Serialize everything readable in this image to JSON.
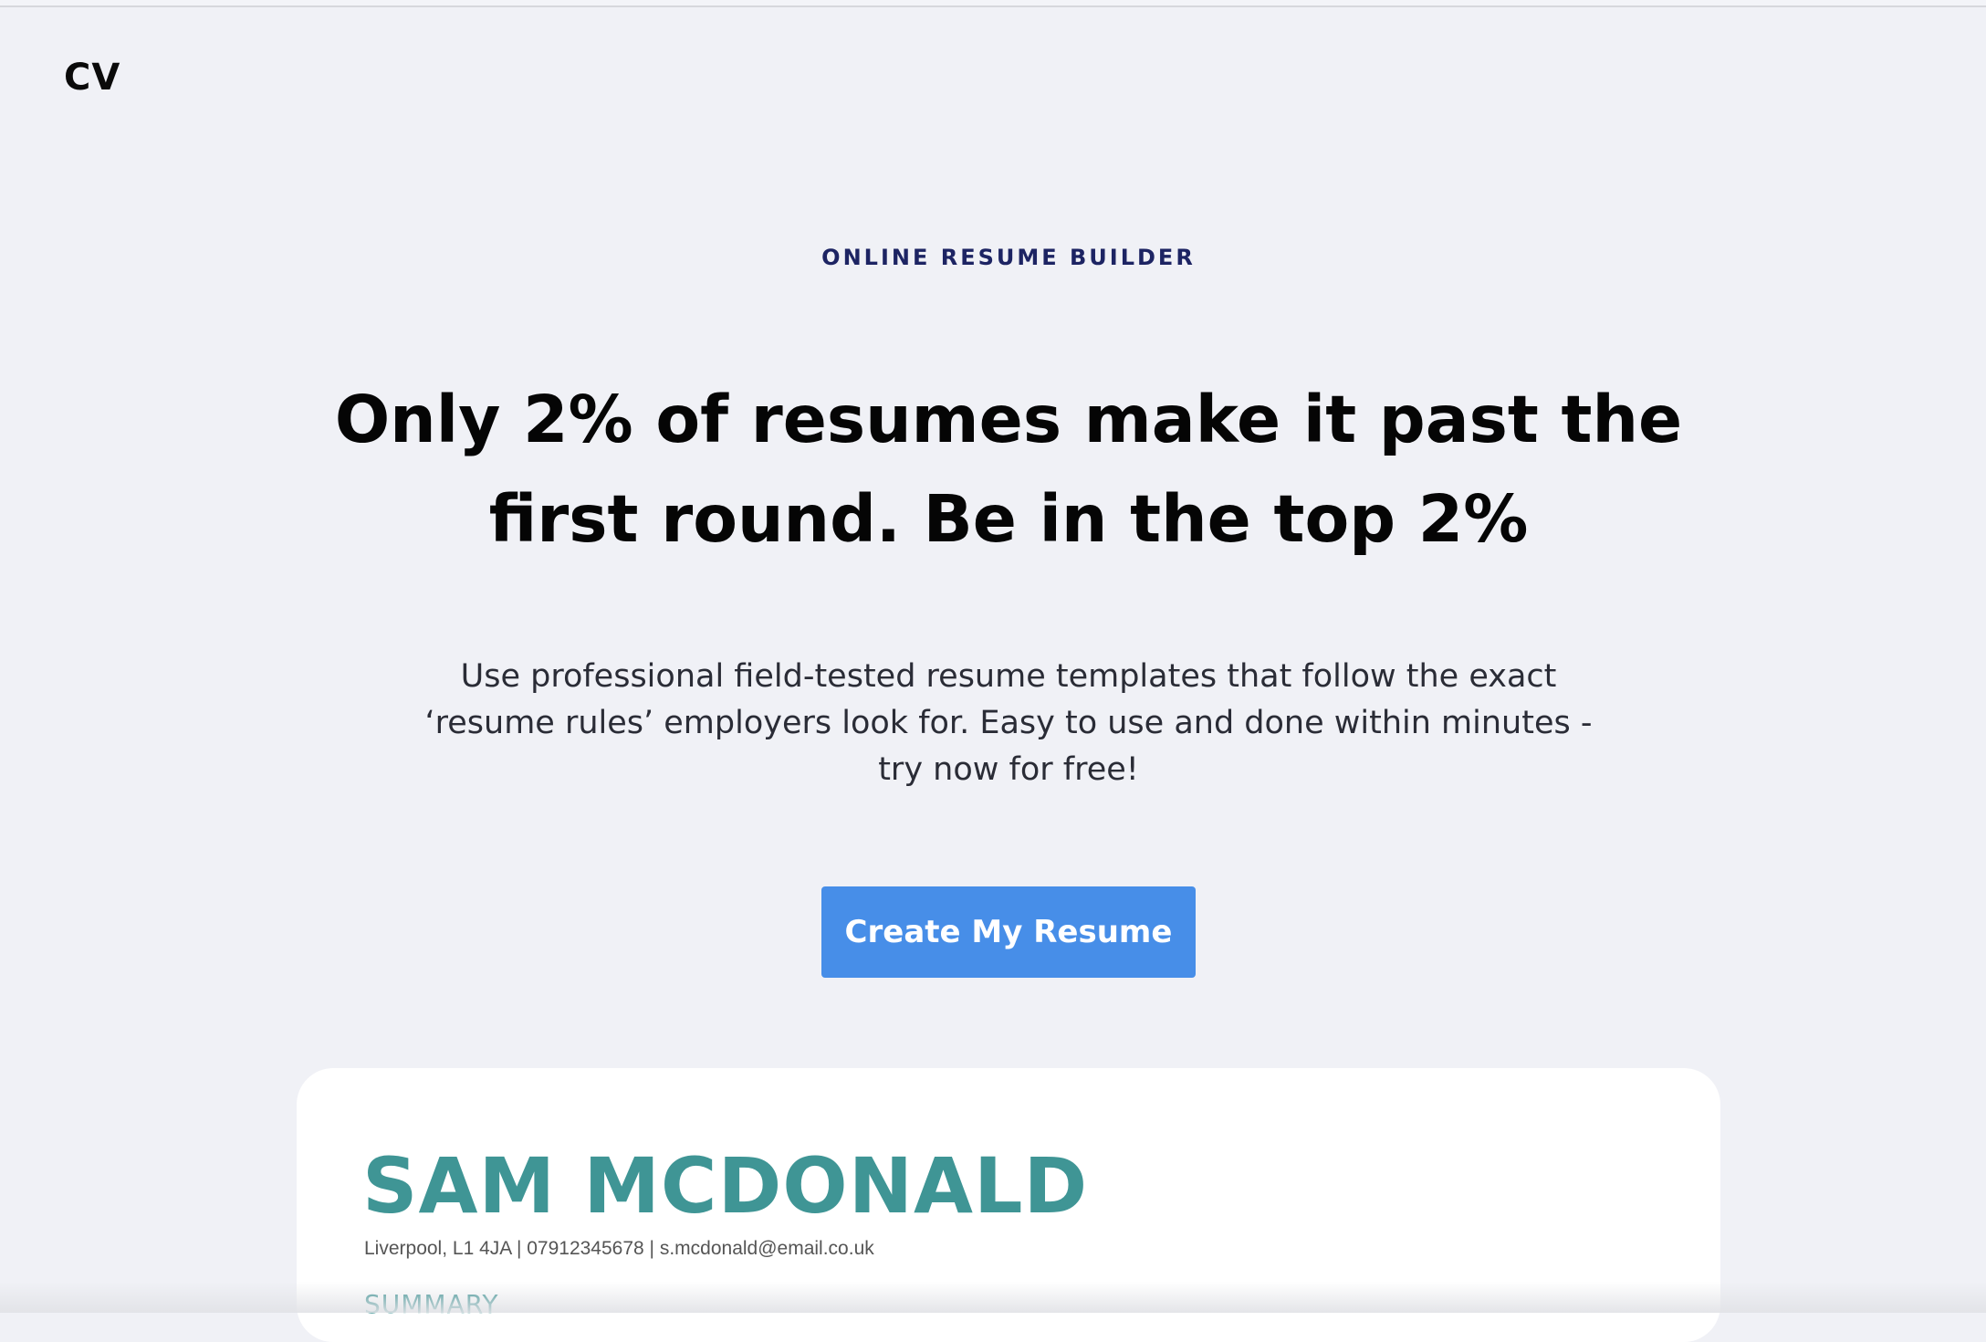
{
  "header": {
    "logo_text": "CV"
  },
  "hero": {
    "eyebrow": "ONLINE RESUME BUILDER",
    "headline": "Only 2% of resumes make it past the first round. Be in the top 2%",
    "subtext": "Use professional field-tested resume templates that follow the exact ‘resume rules’ employers look for. Easy to use and done within minutes - try now for free!",
    "cta_label": "Create My Resume"
  },
  "resume_preview": {
    "name": "SAM MCDONALD",
    "contact": "Liverpool, L1 4JA | 07912345678 | s.mcdonald@email.co.uk",
    "section_heading": "SUMMARY"
  },
  "colors": {
    "background": "#f0f1f6",
    "accent_button": "#478ee8",
    "eyebrow_text": "#1d2463",
    "resume_name": "#3f9595"
  }
}
